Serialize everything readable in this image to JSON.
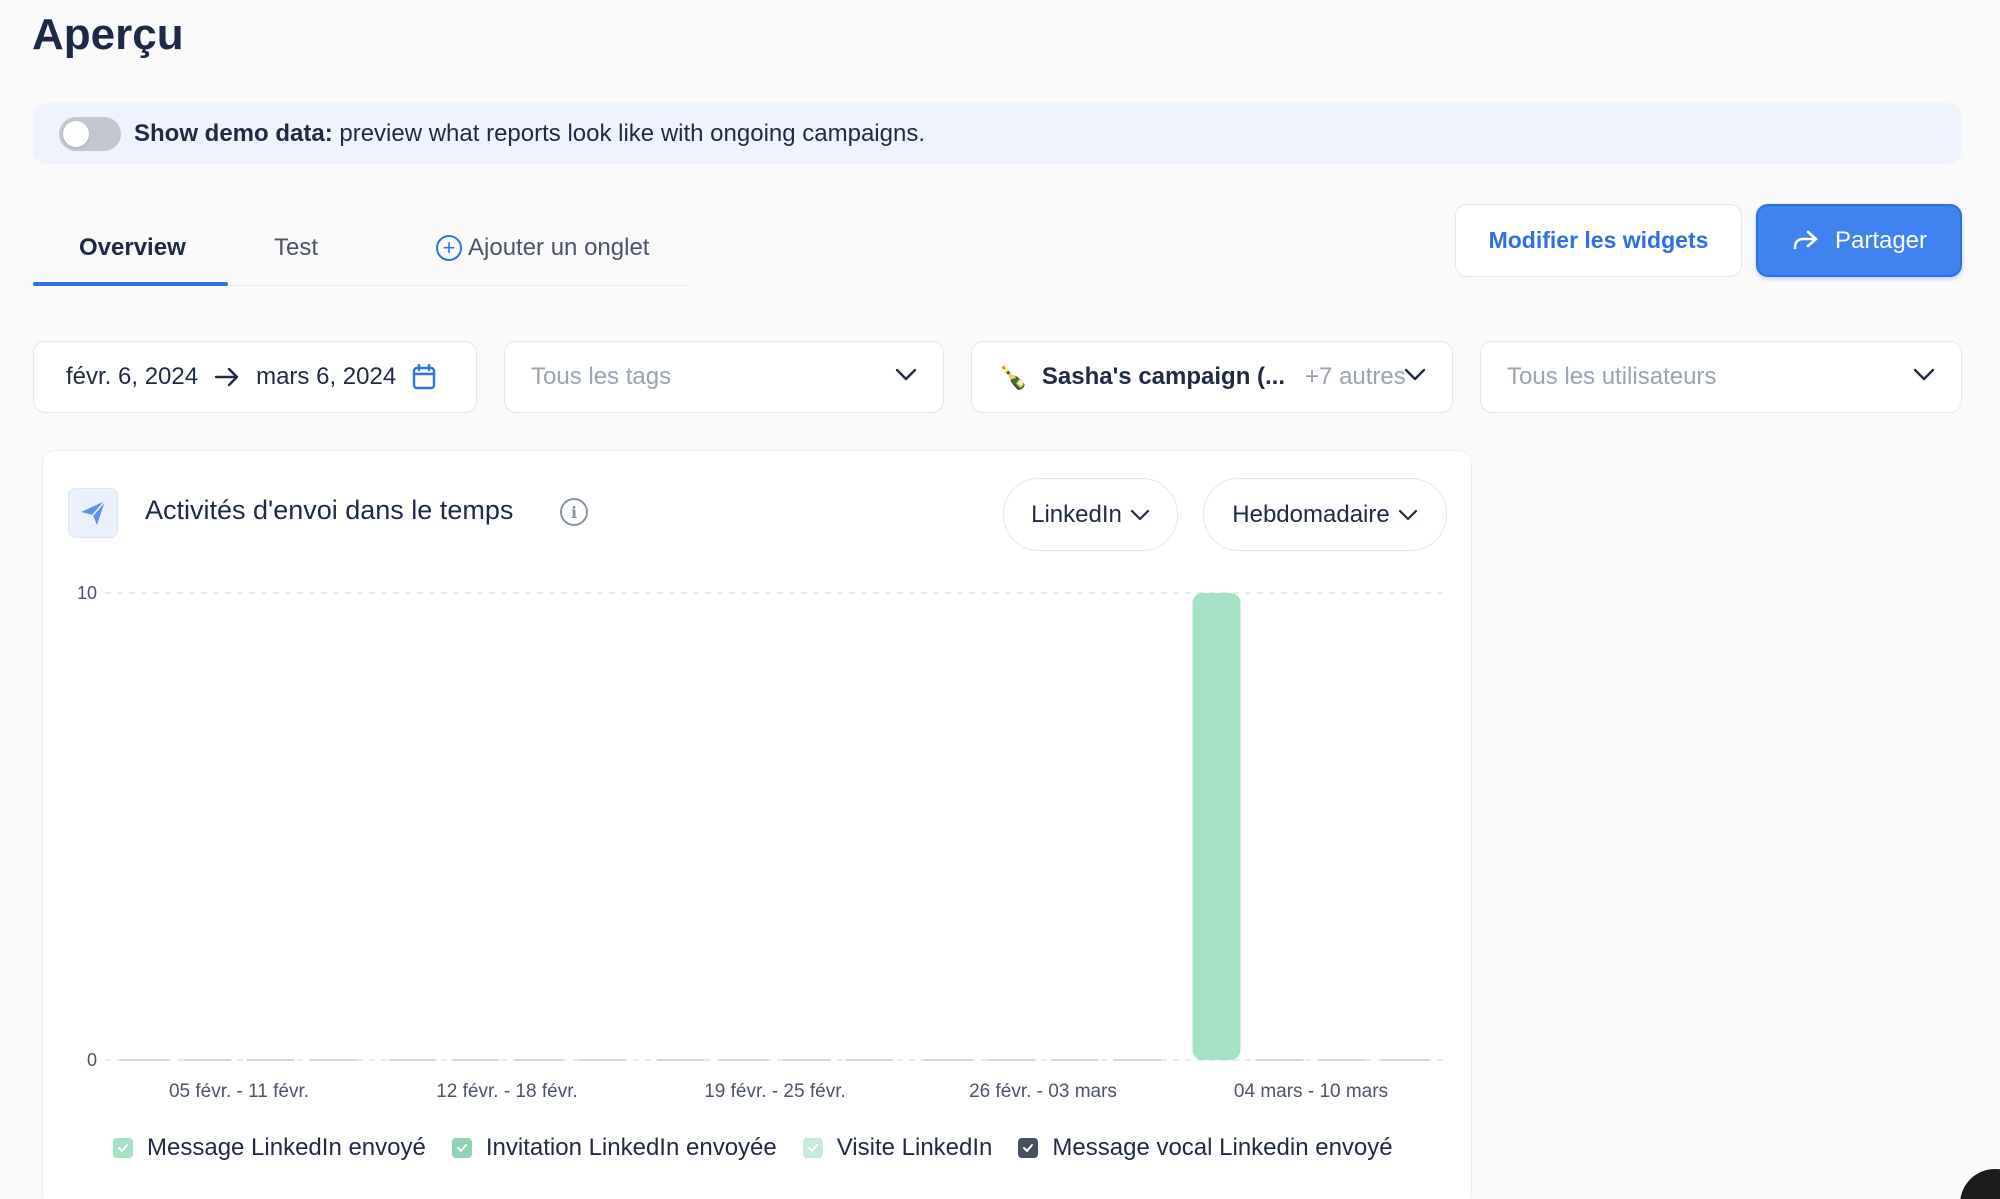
{
  "page": {
    "title": "Aperçu"
  },
  "demo_banner": {
    "bold": "Show demo data:",
    "text": " preview what reports look like with ongoing campaigns."
  },
  "tabs": [
    {
      "label": "Overview"
    },
    {
      "label": "Test"
    },
    {
      "label": "Ajouter un onglet"
    }
  ],
  "actions": {
    "edit_widgets": "Modifier les widgets",
    "share": "Partager"
  },
  "filters": {
    "date_start": "févr. 6, 2024",
    "date_end": "mars 6, 2024",
    "tags_placeholder": "Tous les tags",
    "campaign_emoji": "🍾",
    "campaign_name": "Sasha's campaign (...",
    "campaign_others": "+7 autres",
    "users_placeholder": "Tous les utilisateurs"
  },
  "widget": {
    "title": "Activités d'envoi dans le temps",
    "channel": "LinkedIn",
    "period": "Hebdomadaire",
    "icon": "paper-plane-icon"
  },
  "colors": {
    "accent": "#3370e6",
    "bar_green": "#a6e1c6"
  },
  "chart_data": {
    "type": "bar",
    "categories": [
      "05 févr. - 11 févr.",
      "12 févr. - 18 févr.",
      "19 févr. - 25 févr.",
      "26 févr. - 03 mars",
      "04 mars - 10 mars"
    ],
    "yticks": [
      "0",
      "10"
    ],
    "ylim": [
      0,
      10
    ],
    "grid": true,
    "legend_position": "bottom",
    "series": [
      {
        "name": "Message LinkedIn envoyé",
        "color": "#a6e1c6",
        "values": [
          0,
          0,
          0,
          0,
          10
        ]
      },
      {
        "name": "Invitation LinkedIn envoyée",
        "color": "#8fd3b4",
        "values": [
          0,
          0,
          0,
          0,
          0
        ]
      },
      {
        "name": "Visite LinkedIn",
        "color": "#c6ecd9",
        "values": [
          0,
          0,
          0,
          0,
          0
        ]
      },
      {
        "name": "Message vocal Linkedin envoyé",
        "color": "#44505f",
        "values": [
          0,
          0,
          0,
          0,
          0
        ]
      }
    ]
  }
}
